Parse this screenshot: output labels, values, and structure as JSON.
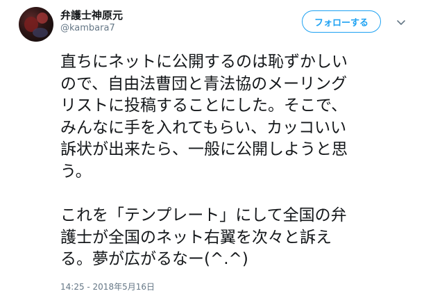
{
  "user": {
    "display_name": "弁護士神原元",
    "handle": "@kambara7"
  },
  "follow_button": {
    "label": "フォローする"
  },
  "menu": {
    "icon": "chevron-down-icon"
  },
  "tweet": {
    "paragraph1": [
      "直ちにネットに公開するのは恥ずかしい",
      "ので、自由法曹団と青法協のメーリング",
      "リストに投稿することにした。そこで、",
      "みんなに手を入れてもらい、カッコいい",
      "訴状が出来たら、一般に公開しようと思",
      "う。"
    ],
    "paragraph2": [
      "これを「テンプレート」にして全国の弁",
      "護士が全国のネット右翼を次々と訴え",
      "る。夢が広がるなー(^.^)"
    ],
    "timestamp": "14:25 - 2018年5月16日"
  },
  "colors": {
    "accent": "#1da1f2",
    "text": "#14171a",
    "muted": "#657786"
  }
}
